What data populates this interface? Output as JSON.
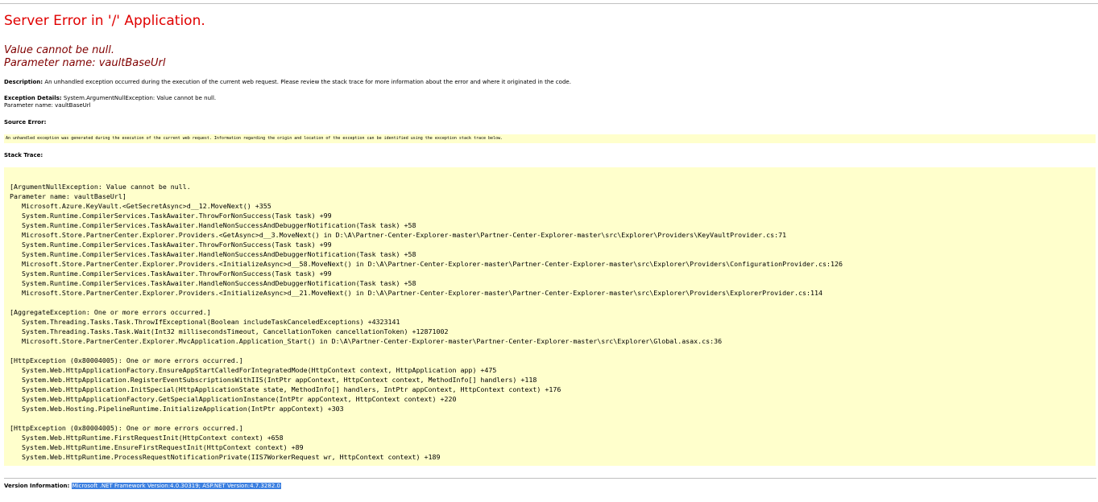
{
  "title": "Server Error in '/' Application.",
  "error_message": {
    "line1": "Value cannot be null.",
    "line2": "Parameter name: vaultBaseUrl"
  },
  "description": {
    "label": "Description:",
    "text": "An unhandled exception occurred during the execution of the current web request. Please review the stack trace for more information about the error and where it originated in the code."
  },
  "exception_details": {
    "label": "Exception Details:",
    "text": "System.ArgumentNullException: Value cannot be null.",
    "text2": "Parameter name: vaultBaseUrl"
  },
  "source_error": {
    "label": "Source Error:",
    "text": "An unhandled exception was generated during the execution of the current web request. Information regarding the origin and location of the exception can be identified using the exception stack trace below."
  },
  "stack_trace": {
    "label": "Stack Trace:",
    "text": "[ArgumentNullException: Value cannot be null.\nParameter name: vaultBaseUrl]\n   Microsoft.Azure.KeyVault.<GetSecretAsync>d__12.MoveNext() +355\n   System.Runtime.CompilerServices.TaskAwaiter.ThrowForNonSuccess(Task task) +99\n   System.Runtime.CompilerServices.TaskAwaiter.HandleNonSuccessAndDebuggerNotification(Task task) +58\n   Microsoft.Store.PartnerCenter.Explorer.Providers.<GetAsync>d__3.MoveNext() in D:\\A\\Partner-Center-Explorer-master\\Partner-Center-Explorer-master\\src\\Explorer\\Providers\\KeyVaultProvider.cs:71\n   System.Runtime.CompilerServices.TaskAwaiter.ThrowForNonSuccess(Task task) +99\n   System.Runtime.CompilerServices.TaskAwaiter.HandleNonSuccessAndDebuggerNotification(Task task) +58\n   Microsoft.Store.PartnerCenter.Explorer.Providers.<InitializeAsync>d__58.MoveNext() in D:\\A\\Partner-Center-Explorer-master\\Partner-Center-Explorer-master\\src\\Explorer\\Providers\\ConfigurationProvider.cs:126\n   System.Runtime.CompilerServices.TaskAwaiter.ThrowForNonSuccess(Task task) +99\n   System.Runtime.CompilerServices.TaskAwaiter.HandleNonSuccessAndDebuggerNotification(Task task) +58\n   Microsoft.Store.PartnerCenter.Explorer.Providers.<InitializeAsync>d__21.MoveNext() in D:\\A\\Partner-Center-Explorer-master\\Partner-Center-Explorer-master\\src\\Explorer\\Providers\\ExplorerProvider.cs:114\n\n[AggregateException: One or more errors occurred.]\n   System.Threading.Tasks.Task.ThrowIfExceptional(Boolean includeTaskCanceledExceptions) +4323141\n   System.Threading.Tasks.Task.Wait(Int32 millisecondsTimeout, CancellationToken cancellationToken) +12871002\n   Microsoft.Store.PartnerCenter.Explorer.MvcApplication.Application_Start() in D:\\A\\Partner-Center-Explorer-master\\Partner-Center-Explorer-master\\src\\Explorer\\Global.asax.cs:36\n\n[HttpException (0x80004005): One or more errors occurred.]\n   System.Web.HttpApplicationFactory.EnsureAppStartCalledForIntegratedMode(HttpContext context, HttpApplication app) +475\n   System.Web.HttpApplication.RegisterEventSubscriptionsWithIIS(IntPtr appContext, HttpContext context, MethodInfo[] handlers) +118\n   System.Web.HttpApplication.InitSpecial(HttpApplicationState state, MethodInfo[] handlers, IntPtr appContext, HttpContext context) +176\n   System.Web.HttpApplicationFactory.GetSpecialApplicationInstance(IntPtr appContext, HttpContext context) +220\n   System.Web.Hosting.PipelineRuntime.InitializeApplication(IntPtr appContext) +303\n\n[HttpException (0x80004005): One or more errors occurred.]\n   System.Web.HttpRuntime.FirstRequestInit(HttpContext context) +658\n   System.Web.HttpRuntime.EnsureFirstRequestInit(HttpContext context) +89\n   System.Web.HttpRuntime.ProcessRequestNotificationPrivate(IIS7WorkerRequest wr, HttpContext context) +189"
  },
  "version_info": {
    "label": "Version Information:",
    "text": "Microsoft .NET Framework Version:4.0.30319; ASP.NET Version:4.7.3282.0"
  },
  "colors": {
    "title": "#e00000",
    "message": "#800000",
    "code_background": "#ffffcc",
    "selection": "#3b7fe0"
  }
}
